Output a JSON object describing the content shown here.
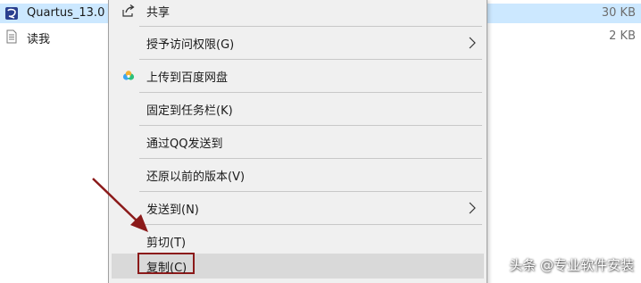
{
  "files": [
    {
      "name": "Quartus_13.0",
      "size": "30 KB",
      "icon": "quartus-app-icon",
      "selected": true
    },
    {
      "name": "读我",
      "size": "2 KB",
      "icon": "text-document-icon",
      "selected": false
    }
  ],
  "context_menu": {
    "items": [
      {
        "label": "共享",
        "icon": "share-icon"
      },
      {
        "label": "授予访问权限(G)",
        "submenu": true
      },
      {
        "label": "上传到百度网盘",
        "icon": "baidu-netdisk-icon"
      },
      {
        "label": "固定到任务栏(K)"
      },
      {
        "label": "通过QQ发送到"
      },
      {
        "label": "还原以前的版本(V)"
      },
      {
        "label": "发送到(N)",
        "submenu": true
      },
      {
        "label": "剪切(T)"
      },
      {
        "label": "复制(C)",
        "hovered": true,
        "annotated": true
      }
    ]
  },
  "colors": {
    "menu_background": "#f0f0f0",
    "hover_background": "#d9d9d9",
    "selected_row": "#cce8ff",
    "annotation": "#8b1a1a"
  },
  "watermark": "头条 @专业软件安装"
}
